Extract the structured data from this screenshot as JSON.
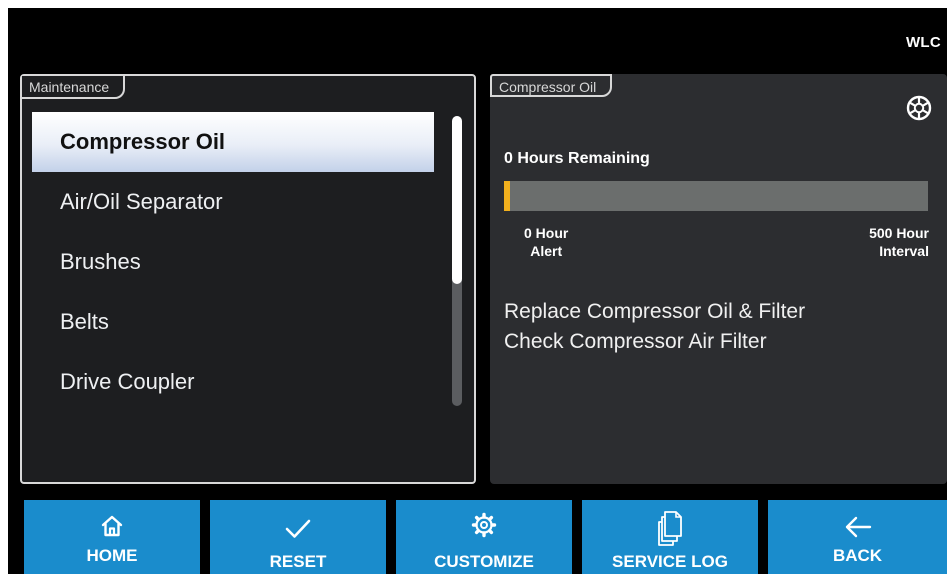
{
  "header": {
    "brand": "WLC"
  },
  "maintenance": {
    "title": "Maintenance",
    "items": [
      {
        "label": "Compressor Oil",
        "selected": true
      },
      {
        "label": "Air/Oil Separator",
        "selected": false
      },
      {
        "label": "Brushes",
        "selected": false
      },
      {
        "label": "Belts",
        "selected": false
      },
      {
        "label": "Drive Coupler",
        "selected": false
      }
    ]
  },
  "detail": {
    "title": "Compressor Oil",
    "icon": "service-gear-icon",
    "hours_remaining": "0 Hours Remaining",
    "progress_fraction": 0.0,
    "scale_left": {
      "line1": "0 Hour",
      "line2": "Alert"
    },
    "scale_right": {
      "line1": "500 Hour",
      "line2": "Interval"
    },
    "tasks": [
      "Replace Compressor Oil & Filter",
      "Check Compressor Air Filter"
    ]
  },
  "buttons": {
    "home": {
      "label": "HOME",
      "icon": "home-icon"
    },
    "reset": {
      "label": "RESET",
      "icon": "check-icon"
    },
    "customize": {
      "label": "CUSTOMIZE",
      "icon": "gear-icon"
    },
    "service_log": {
      "label": "SERVICE LOG",
      "icon": "documents-icon"
    },
    "back": {
      "label": "BACK",
      "icon": "arrow-left-icon"
    }
  },
  "colors": {
    "button": "#1a8ccc",
    "progress_marker": "#f2b01d",
    "progress_track": "#6b6e6d"
  }
}
